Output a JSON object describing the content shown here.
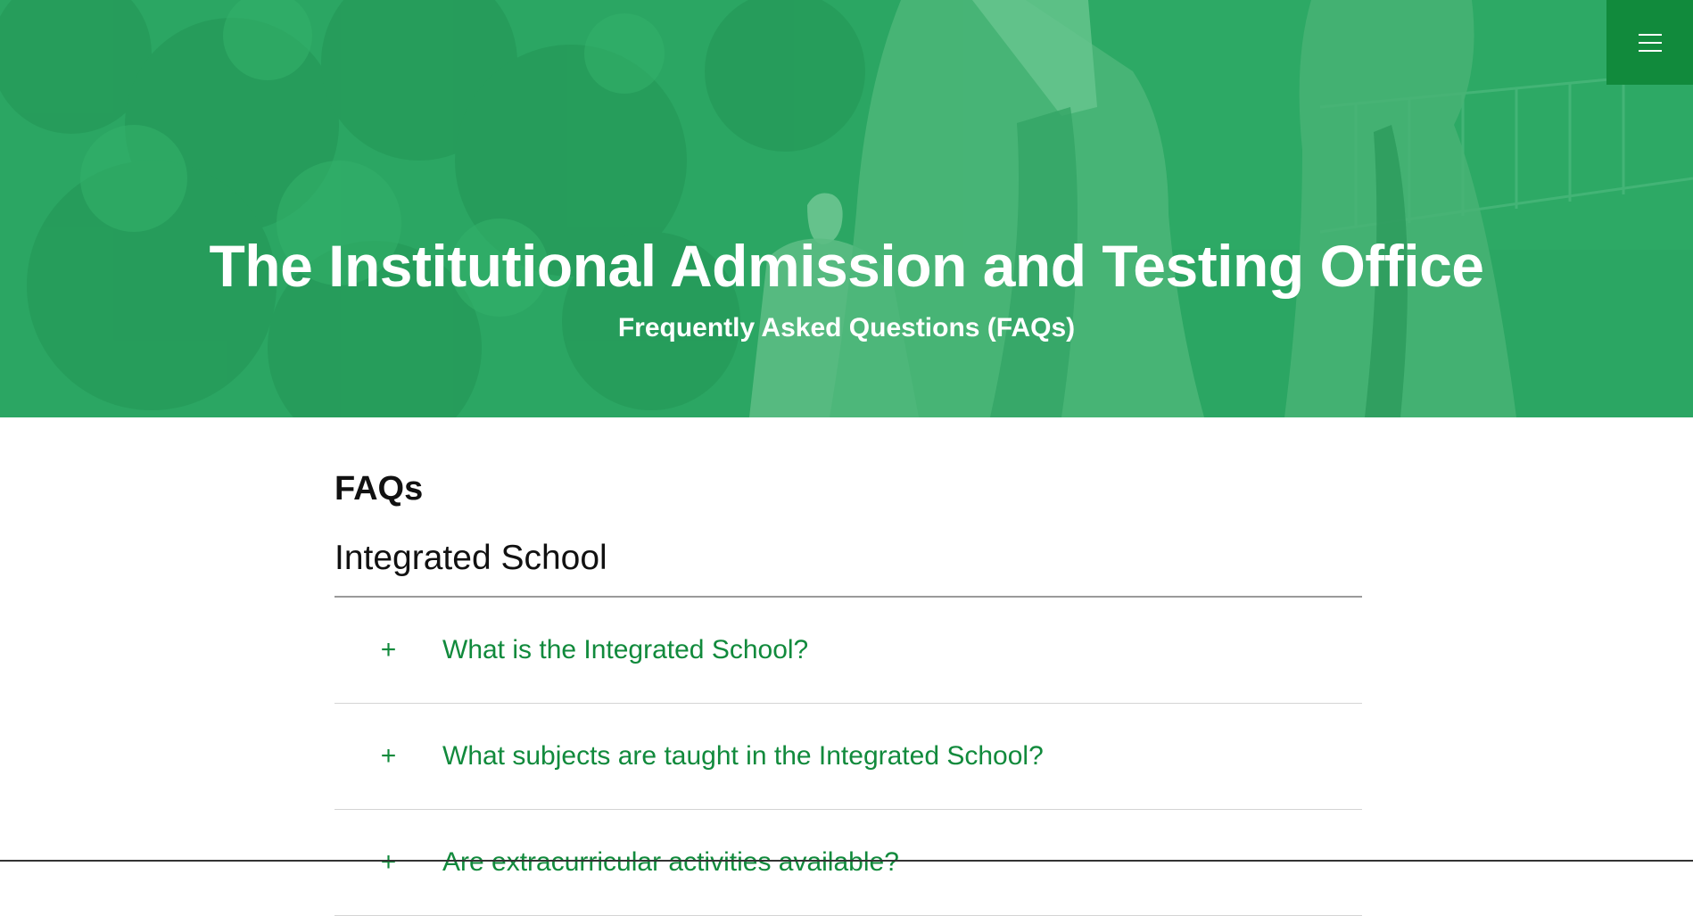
{
  "hero": {
    "title": "The Institutional Admission and Testing Office",
    "subtitle": "Frequently Asked Questions (FAQs)"
  },
  "header": {
    "menu_icon": "hamburger-menu-icon"
  },
  "main": {
    "section_title": "FAQs",
    "category": "Integrated School",
    "faqs": [
      {
        "icon": "plus",
        "question": "What is the Integrated School?"
      },
      {
        "icon": "plus",
        "question": "What subjects are taught in the Integrated School?"
      },
      {
        "icon": "plus",
        "question": "Are extracurricular activities available?"
      }
    ]
  },
  "colors": {
    "hero_green": "#2faa68",
    "brand_green": "#118a3c",
    "text_dark": "#111111"
  }
}
